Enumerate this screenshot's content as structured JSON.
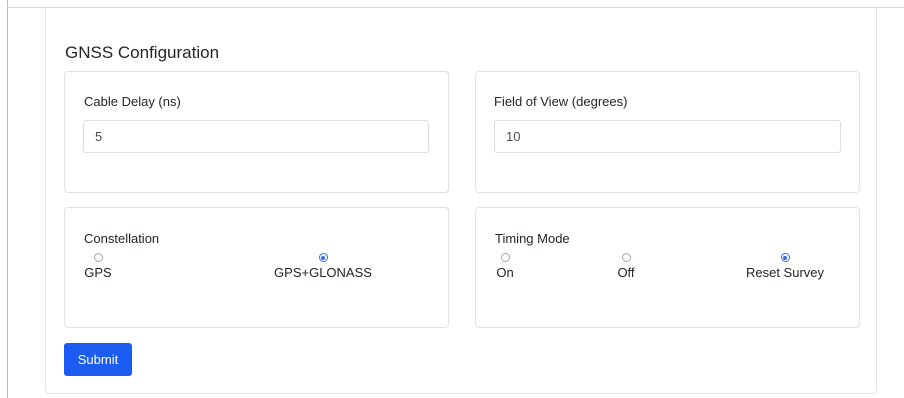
{
  "form": {
    "title": "GNSS Configuration",
    "cable_delay": {
      "label": "Cable Delay (ns)",
      "value": "5"
    },
    "field_of_view": {
      "label": "Field of View (degrees)",
      "value": "10"
    },
    "constellation": {
      "label": "Constellation",
      "options": [
        {
          "label": "GPS",
          "checked": false
        },
        {
          "label": "GPS+GLONASS",
          "checked": true
        }
      ]
    },
    "timing_mode": {
      "label": "Timing Mode",
      "options": [
        {
          "label": "On",
          "checked": false
        },
        {
          "label": "Off",
          "checked": false
        },
        {
          "label": "Reset Survey",
          "checked": true
        }
      ]
    },
    "submit_label": "Submit"
  },
  "colors": {
    "accent": "#1b5cf2",
    "radio_checked": "#2f6ef0",
    "border": "#e2e2e2"
  }
}
